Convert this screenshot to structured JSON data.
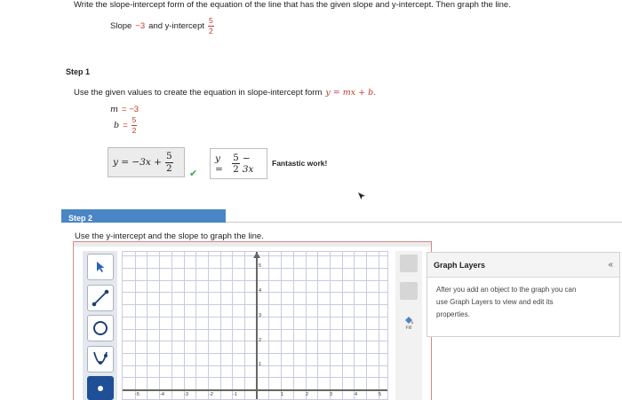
{
  "question": {
    "text": "Write the slope-intercept form of the equation of the line that has the given slope and y-intercept. Then graph the line.",
    "given_prefix": "Slope",
    "slope": "−3",
    "given_mid": "and y-intercept",
    "intercept_num": "5",
    "intercept_den": "2"
  },
  "step1": {
    "label": "Step 1",
    "instruction": "Use the given values to create the equation in slope-intercept form",
    "form": "y = mx + b.",
    "m_var": "m",
    "m_value": "= −3",
    "b_var": "b",
    "b_eq": "=",
    "b_num": "5",
    "b_den": "2",
    "answer_prefix": "y = −3x +",
    "answer_num": "5",
    "answer_den": "2",
    "check_mark": "✔",
    "user_prefix": "y =",
    "user_num": "5",
    "user_den": "2",
    "user_suffix": "− 3x",
    "feedback": "Fantastic work!"
  },
  "step2": {
    "label": "Step 2",
    "instruction": "Use the y-intercept and the slope to graph the line."
  },
  "graph": {
    "y_tick_labels": [
      "5",
      "4",
      "3",
      "2",
      "1"
    ],
    "x_tick_labels": [
      "-5",
      "-4",
      "-3",
      "-2",
      "-1",
      "1",
      "2",
      "3",
      "4",
      "5"
    ],
    "tools": [
      "pointer-tool",
      "line-tool",
      "circle-tool",
      "parabola-tool",
      "point-tool"
    ],
    "fill_label": "Fill"
  },
  "layers_panel": {
    "title": "Graph Layers",
    "collapse": "«",
    "description": "After you add an object to the graph you can use Graph Layers to view and edit its properties."
  },
  "colors": {
    "accent": "#4a86c5",
    "highlight": "#c0392b",
    "success": "#3aa655",
    "grid": "#c8cbe0"
  }
}
